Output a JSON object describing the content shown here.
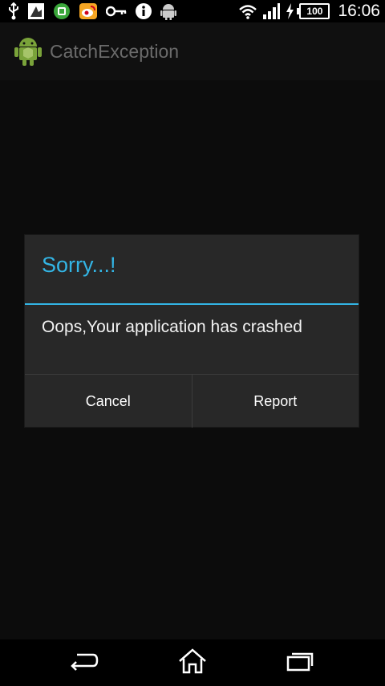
{
  "status_bar": {
    "icons": [
      "usb-icon",
      "photo-notification-icon",
      "green-app-icon",
      "weibo-icon",
      "key-icon",
      "info-icon",
      "android-icon"
    ],
    "battery_level": "100",
    "time": "16:06"
  },
  "action_bar": {
    "title": "CatchException"
  },
  "dialog": {
    "title": "Sorry...!",
    "message": "Oops,Your application has crashed",
    "cancel_label": "Cancel",
    "report_label": "Report"
  },
  "nav_bar": {
    "buttons": [
      "back-icon",
      "home-icon",
      "recent-apps-icon"
    ]
  },
  "colors": {
    "accent": "#33b5e5",
    "dialog_bg": "#282828",
    "title_gray": "#6b6b6b",
    "android_green": "#7aa33a"
  }
}
